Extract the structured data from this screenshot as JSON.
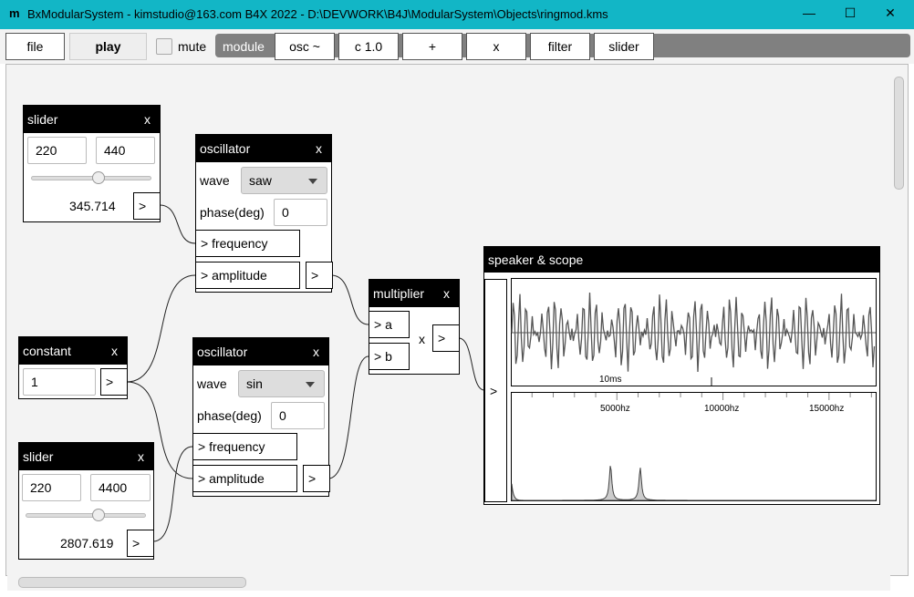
{
  "window": {
    "title": "BxModularSystem - kimstudio@163.com B4X 2022 - D:\\DEVWORK\\B4J\\ModularSystem\\Objects\\ringmod.kms",
    "logo": "m",
    "minimize": "—",
    "maximize": "☐",
    "close": "✕"
  },
  "toolbar": {
    "file": "file",
    "play": "play",
    "mute": "mute",
    "module": "module",
    "osc": "osc ~",
    "const": "c 1.0",
    "add": "+",
    "mul": "x",
    "filter": "filter",
    "slider": "slider"
  },
  "slider1": {
    "title": "slider",
    "close": "x",
    "min": "220",
    "max": "440",
    "value": "345.714",
    "position": 0.57,
    "out": ">"
  },
  "osc1": {
    "title": "oscillator",
    "close": "x",
    "wave_label": "wave",
    "wave": "saw",
    "phase_label": "phase(deg)",
    "phase": "0",
    "freq": "> frequency",
    "amp": "> amplitude",
    "out": ">"
  },
  "constant": {
    "title": "constant",
    "close": "x",
    "value": "1",
    "out": ">"
  },
  "osc2": {
    "title": "oscillator",
    "close": "x",
    "wave_label": "wave",
    "wave": "sin",
    "phase_label": "phase(deg)",
    "phase": "0",
    "freq": "> frequency",
    "amp": "> amplitude",
    "out": ">"
  },
  "slider2": {
    "title": "slider",
    "close": "x",
    "min": "220",
    "max": "4400",
    "value": "2807.619",
    "position": 0.62,
    "out": ">"
  },
  "multiplier": {
    "title": "multiplier",
    "close": "x",
    "a": "> a",
    "b": "> b",
    "op": "x",
    "out": ">"
  },
  "speaker": {
    "title": "speaker & scope",
    "in": ">",
    "time_label": "10ms",
    "freq_labels": [
      "5000hz",
      "10000hz",
      "15000hz"
    ],
    "spectrum_peaks_hz": [
      4700,
      6100
    ],
    "spectrum_max_hz": 17200
  }
}
